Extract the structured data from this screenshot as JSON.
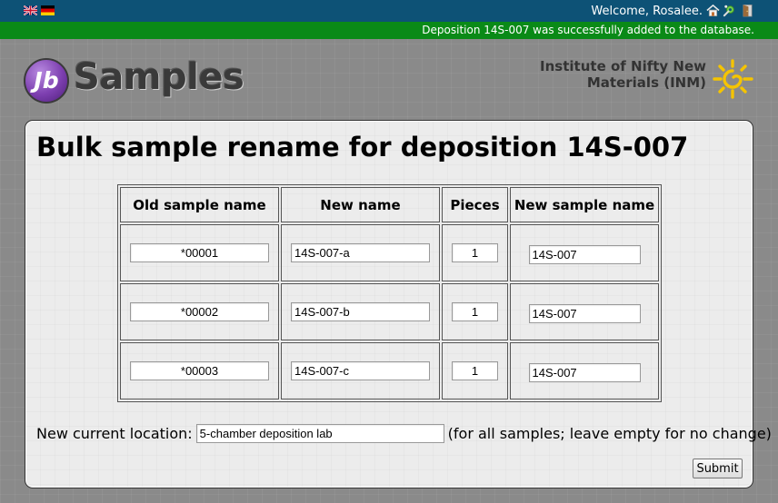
{
  "header": {
    "welcome": "Welcome, Rosalee.",
    "icons": [
      "uk-flag-icon",
      "german-flag-icon",
      "home-icon",
      "preferences-icon",
      "logout-icon"
    ]
  },
  "notification": {
    "message": "Deposition 14S-007 was successfully added to the database."
  },
  "branding": {
    "logo_badge": "Jb",
    "logo_text": "Samples",
    "institute_line1": "Institute of Nifty New",
    "institute_line2": "Materials (INM)"
  },
  "page": {
    "title": "Bulk sample rename for deposition 14S-007"
  },
  "table": {
    "headers": [
      "Old sample name",
      "New name",
      "Pieces",
      "New sample name"
    ],
    "rows": [
      {
        "old": "*00001",
        "new": "14S-007-a",
        "pieces": "1",
        "new_sample": "14S-007"
      },
      {
        "old": "*00002",
        "new": "14S-007-b",
        "pieces": "1",
        "new_sample": "14S-007"
      },
      {
        "old": "*00003",
        "new": "14S-007-c",
        "pieces": "1",
        "new_sample": "14S-007"
      }
    ]
  },
  "location": {
    "label": "New current location:",
    "value": "5-chamber deposition lab",
    "hint": "(for all samples; leave empty for no change)"
  },
  "form": {
    "submit_label": "Submit"
  },
  "colors": {
    "header_bg": "#0d5276",
    "success_bg": "#0a8a17",
    "page_bg": "#8a8a8a",
    "panel_bg": "#ececec"
  }
}
